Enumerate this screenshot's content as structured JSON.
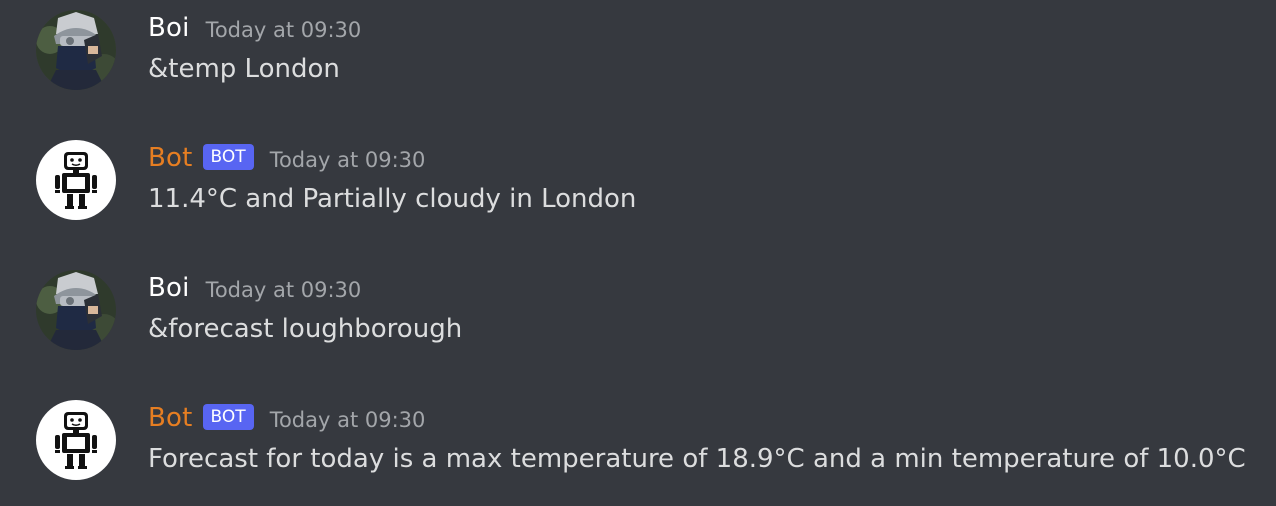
{
  "messages": [
    {
      "author": "Boi",
      "is_bot": false,
      "bot_tag": "",
      "timestamp": "Today at 09:30",
      "text": "&temp London",
      "avatar_icon": "ninja-user-avatar"
    },
    {
      "author": "Bot",
      "is_bot": true,
      "bot_tag": "BOT",
      "timestamp": "Today at 09:30",
      "text": "11.4°C and Partially cloudy in London",
      "avatar_icon": "robot-avatar"
    },
    {
      "author": "Boi",
      "is_bot": false,
      "bot_tag": "",
      "timestamp": "Today at 09:30",
      "text": "&forecast loughborough",
      "avatar_icon": "ninja-user-avatar"
    },
    {
      "author": "Bot",
      "is_bot": true,
      "bot_tag": "BOT",
      "timestamp": "Today at 09:30",
      "text": "Forecast for today is a max temperature of 18.9°C and a min temperature of 10.0°C",
      "avatar_icon": "robot-avatar"
    }
  ],
  "colors": {
    "background": "#36393f",
    "bot_name": "#e67e22",
    "bot_tag": "#5865f2",
    "timestamp": "#a3a6aa",
    "text": "#dcddde"
  }
}
